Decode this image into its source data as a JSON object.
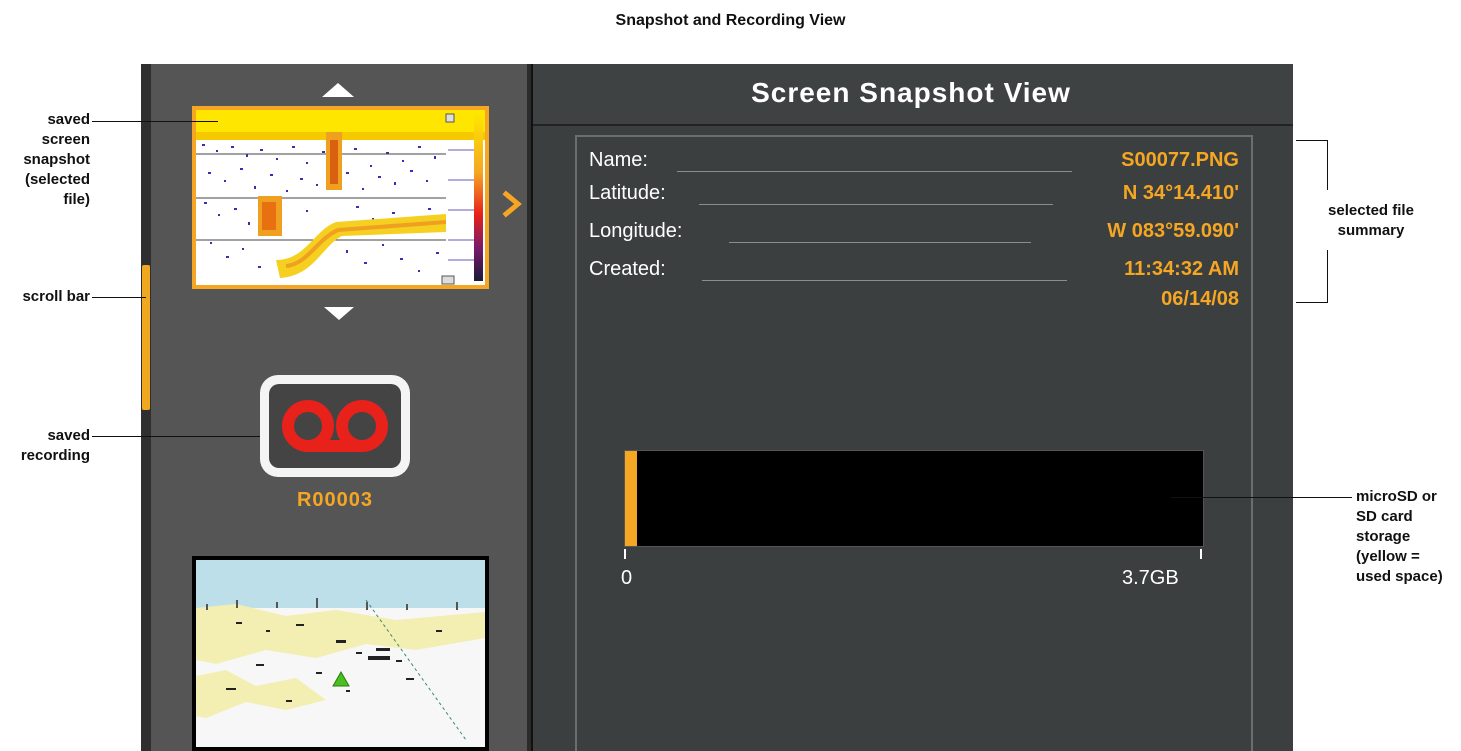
{
  "figure_title": "Snapshot and Recording View",
  "left_panel": {
    "recording_label": "R00003",
    "scroll_position_fraction": 0.32
  },
  "right_panel": {
    "title": "Screen Snapshot View",
    "summary": [
      {
        "key": "Name:",
        "value": "S00077.PNG"
      },
      {
        "key": "Latitude:",
        "value": "N 34°14.410'"
      },
      {
        "key": "Longitude:",
        "value": "W 083°59.090'"
      },
      {
        "key": "Created:",
        "value": "11:34:32 AM",
        "value2": "06/14/08"
      }
    ],
    "storage": {
      "min_label": "0",
      "max_label": "3.7GB",
      "used_fraction": 0.004
    }
  },
  "callouts": {
    "snapshot": [
      "saved",
      "screen",
      "snapshot",
      "(selected",
      "file)"
    ],
    "scroll": [
      "scroll bar"
    ],
    "recording": [
      "saved",
      "recording"
    ],
    "summary": [
      "selected file",
      "summary"
    ],
    "storage": [
      "microSD or",
      "SD card",
      "storage",
      "(yellow =",
      "used space)"
    ]
  },
  "colors": {
    "accent": "#f5a623",
    "recording_red": "#e8211b",
    "panel_dark": "#3b3f3f",
    "panel_mid": "#555555"
  },
  "icons": {
    "up": "up-arrow-icon",
    "down": "down-arrow-icon",
    "caret": "chevron-right-icon",
    "recording": "voicemail-recording-icon"
  }
}
